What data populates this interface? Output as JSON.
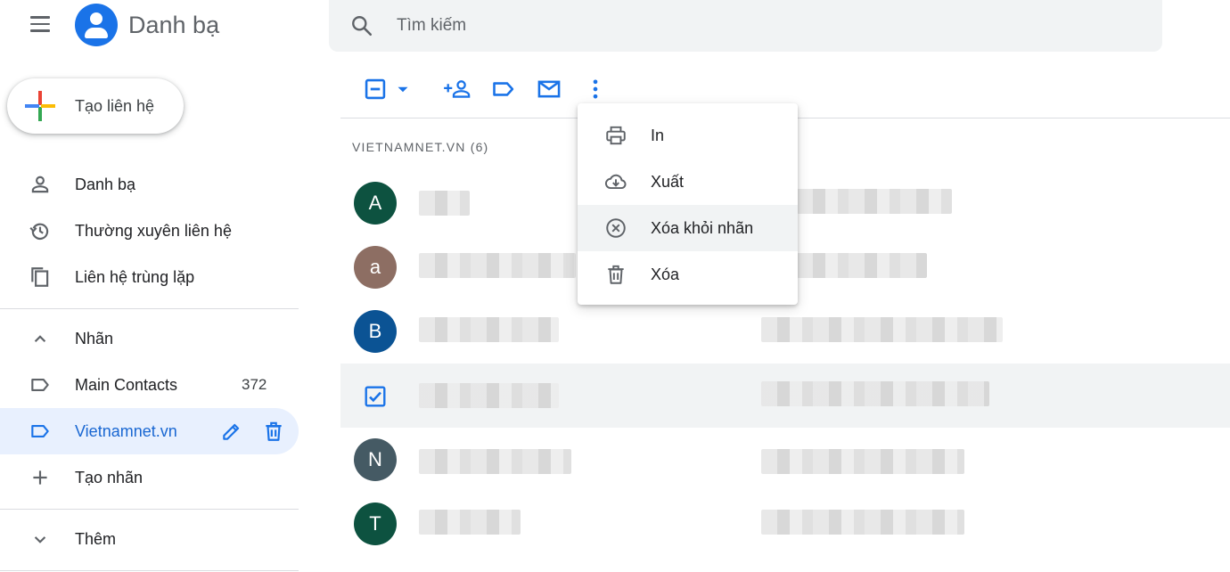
{
  "header": {
    "app_title": "Danh bạ",
    "search_placeholder": "Tìm kiếm"
  },
  "sidebar": {
    "create_label": "Tạo liên hệ",
    "nav": [
      {
        "label": "Danh bạ",
        "icon": "person-icon"
      },
      {
        "label": "Thường xuyên liên hệ",
        "icon": "history-icon"
      },
      {
        "label": "Liên hệ trùng lặp",
        "icon": "copy-icon"
      }
    ],
    "labels_header": "Nhãn",
    "labels": [
      {
        "label": "Main Contacts",
        "count": "372",
        "icon": "label-icon"
      },
      {
        "label": "Vietnamnet.vn",
        "icon": "label-icon",
        "active": true
      }
    ],
    "create_label_item": "Tạo nhãn",
    "more": "Thêm"
  },
  "list": {
    "section_title": "VIETNAMNET.VN (6)",
    "contacts": [
      {
        "initial": "A",
        "color": "#0d5240"
      },
      {
        "initial": "a",
        "color": "#8d6e63"
      },
      {
        "initial": "B",
        "color": "#0b5394"
      },
      {
        "initial": "",
        "selected": true
      },
      {
        "initial": "N",
        "color": "#455a64"
      },
      {
        "initial": "T",
        "color": "#0d5240"
      }
    ]
  },
  "menu": {
    "items": [
      {
        "label": "In",
        "icon": "print-icon"
      },
      {
        "label": "Xuất",
        "icon": "cloud-download-icon"
      },
      {
        "label": "Xóa khỏi nhãn",
        "icon": "remove-circle-icon",
        "highlighted": true
      },
      {
        "label": "Xóa",
        "icon": "trash-icon"
      }
    ]
  },
  "colors": {
    "accent": "#1a73e8",
    "active_bg": "#e8f0fe",
    "active_text": "#1967d2",
    "icon_gray": "#5f6368"
  }
}
